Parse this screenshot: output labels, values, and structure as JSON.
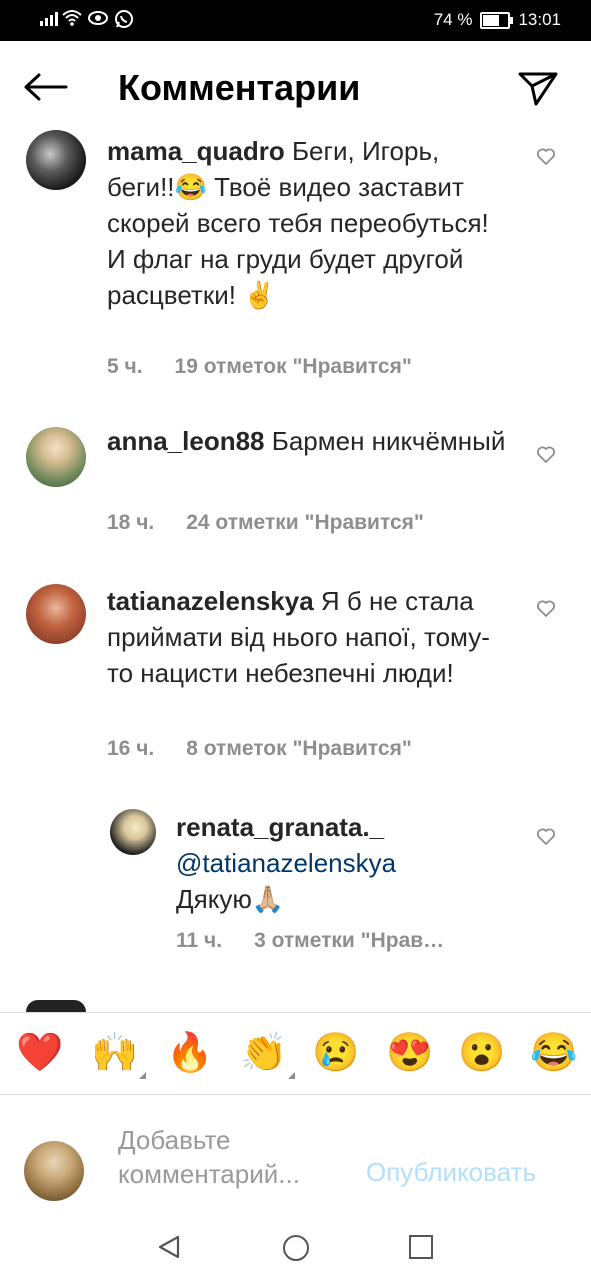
{
  "status_bar": {
    "battery": "74 %",
    "battery_level": 0.74,
    "time": "13:01",
    "icons": [
      "signal-icon",
      "wifi-icon",
      "eye-icon",
      "whatsapp-icon"
    ]
  },
  "header": {
    "title": "Комментарии",
    "back_icon": "arrow-left-icon",
    "share_icon": "paper-plane-icon"
  },
  "comments": [
    {
      "username": "mama_quadro",
      "text": "Беги, Игорь, беги!!😂 Твоё видео заставит скорей всего тебя переобуться! И флаг на груди будет другой расцветки! ✌️",
      "time": "5 ч.",
      "likes": "19 отметок \"Нравится\""
    },
    {
      "username": "anna_leon88",
      "text": "Бармен никчёмный",
      "time": "18 ч.",
      "likes": "24 отметки \"Нравится\""
    },
    {
      "username": "tatianazelenskya",
      "text": "Я б не стала приймати від нього напої, тому-то нацисти небезпечні люди!",
      "time": "16 ч.",
      "likes": "8 отметок \"Нравится\""
    },
    {
      "username": "renata_granata._",
      "mention": "@tatianazelenskya",
      "text": "Дякую🙏🏼",
      "time": "11 ч.",
      "likes": "3 отметки \"Нрав…"
    }
  ],
  "emoji_bar": [
    "❤️",
    "🙌",
    "🔥",
    "👏",
    "😢",
    "😍",
    "😮",
    "😂"
  ],
  "composer": {
    "placeholder": "Добавьте комментарий...",
    "publish_label": "Опубликовать"
  }
}
